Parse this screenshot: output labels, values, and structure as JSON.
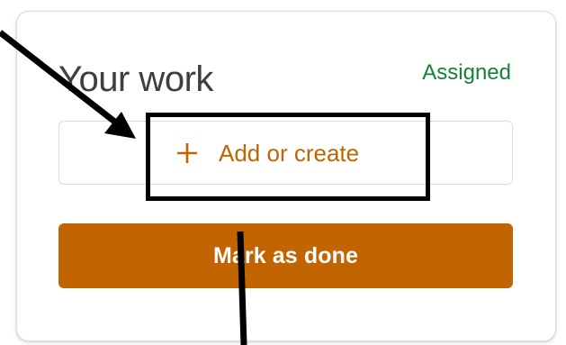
{
  "work_card": {
    "title": "Your work",
    "status": "Assigned",
    "add_or_create_label": "Add or create",
    "add_icon": "plus-icon",
    "mark_done_label": "Mark as done"
  },
  "colors": {
    "accent": "#c26401",
    "status_green": "#188038",
    "title_text": "#3c4043",
    "card_border": "#dadce0",
    "annotation": "#000000"
  },
  "annotations": {
    "highlight": "highlight-box",
    "arrows": [
      "arrow-top-left",
      "arrow-bottom-line"
    ]
  }
}
